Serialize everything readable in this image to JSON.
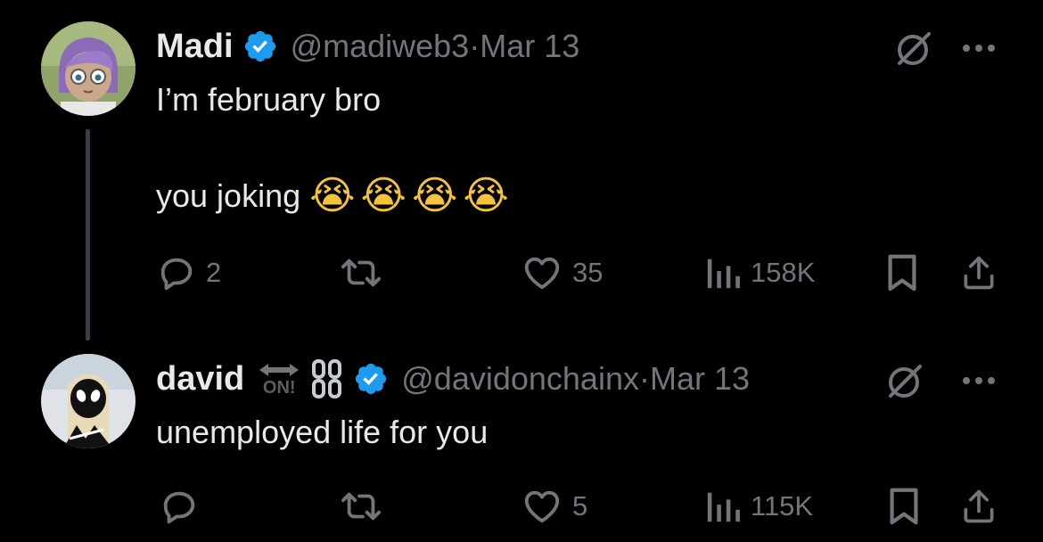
{
  "tweets": [
    {
      "author": {
        "name": "Madi",
        "handle": "@madiweb3",
        "date": "Mar 13",
        "verified": true
      },
      "lines": [
        "I’m february bro",
        "you joking"
      ],
      "emoji": [
        "😭",
        "😭",
        "😭",
        "😭"
      ],
      "stats": {
        "replies": "2",
        "reposts": "",
        "likes": "35",
        "views": "158K"
      }
    },
    {
      "author": {
        "name": "david",
        "badge_text": "ON!",
        "handle": "@davidonchainx",
        "date": "Mar 13",
        "verified": true
      },
      "lines": [
        "unemployed life for you"
      ],
      "stats": {
        "replies": "",
        "reposts": "",
        "likes": "5",
        "views": "115K"
      }
    }
  ],
  "separator": " · ",
  "icons": [
    "grok-icon",
    "more-icon",
    "reply-icon",
    "repost-icon",
    "like-icon",
    "views-icon",
    "bookmark-icon",
    "share-icon",
    "verified-badge-icon"
  ],
  "colors": {
    "background": "#000000",
    "text": "#e7e9ea",
    "muted": "#71767b",
    "verified": "#1d9bf0"
  }
}
